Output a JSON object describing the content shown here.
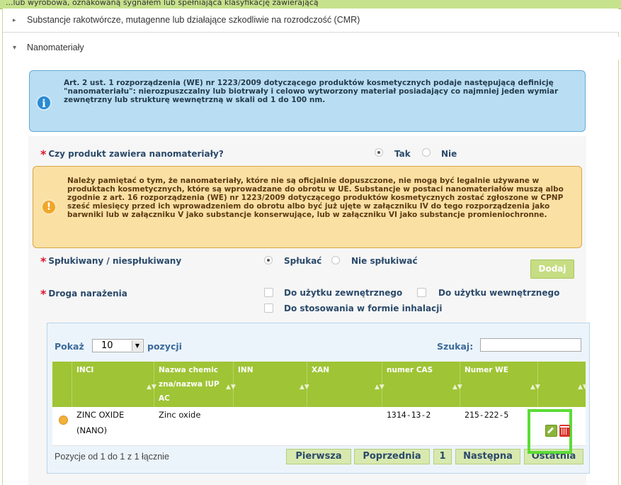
{
  "top_strip": {
    "text": "...lub wyrobowa, oznakowaną sygnałem lub spełniająca klasyfikację zawierającą"
  },
  "accordion": [
    {
      "label": "Substancje rakotwórcze, mutagenne lub działające szkodliwie na rozrodczość (CMR)",
      "state": "collapsed"
    },
    {
      "label": "Nanomateriały",
      "state": "expanded"
    }
  ],
  "info_box": {
    "text": "Art. 2 ust. 1 rozporządzenia (WE) nr 1223/2009 dotyczącego produktów kosmetycznych podaje następującą definicję \"nanomateriału\": nierozpuszczalny lub biotrwały i celowo wytworzony materiał posiadający co najmniej jeden wymiar zewnętrzny lub strukturę wewnętrzną w skali od 1 do 100 nm.",
    "icon": "info-icon",
    "color": "#b9def3"
  },
  "question_nano": {
    "required_marker": "*",
    "label": "Czy produkt zawiera nanomateriały?",
    "options": [
      "Tak",
      "Nie"
    ],
    "selected": "Tak"
  },
  "warning_box": {
    "text": "Należy pamiętać o tym, że nanomateriały, które nie są oficjalnie dopuszczone, nie mogą być legalnie używane w produktach kosmetycznych, które są wprowadzane do obrotu w UE. Substancje w postaci nanomateriałów muszą albo zgodnie z art. 16 rozporządzenia (WE) nr 1223/2009 dotyczącego produktów kosmetycznych zostać zgłoszone w CPNP sześć miesięcy przed ich wprowadzeniem do obrotu albo być już ujęte w załączniku IV do tego rozporządzenia jako barwniki lub w załączniku V jako substancje konserwujące, lub w załączniku VI jako substancje promieniochronne.",
    "icon": "warning-icon",
    "color": "#fbe0a4"
  },
  "question_rinse": {
    "required_marker": "*",
    "label": "Spłukiwany / niespłukiwany",
    "options": [
      "Spłukać",
      "Nie spłukiwać"
    ],
    "selected": "Spłukać"
  },
  "add_button": {
    "label": "Dodaj"
  },
  "question_exposure": {
    "required_marker": "*",
    "label": "Droga narażenia",
    "options": [
      "Do użytku zewnętrznego",
      "Do użytku wewnętrznego",
      "Do stosowania w formie inhalacji"
    ]
  },
  "table": {
    "show_label": "Pokaż",
    "page_size": "10",
    "entries_label": "pozycji",
    "search_label": "Szukaj:",
    "search_value": "",
    "columns": [
      "INCI",
      "Nazwa chemiczna/nazwa IUPAC",
      "INN",
      "XAN",
      "numer CAS",
      "Numer WE",
      ""
    ],
    "rows": [
      {
        "inci": "ZINC OXIDE (NANO)",
        "chem_name": "Zinc oxide",
        "inn": "",
        "xan": "",
        "cas": "1314-13-2",
        "we": "215-222-5"
      }
    ],
    "info": "Pozycje od 1 do 1 z 1 łącznie",
    "pagination": {
      "first": "Pierwsza",
      "prev": "Poprzednia",
      "page": "1",
      "next": "Następna",
      "last": "Ostatnia"
    }
  },
  "colors": {
    "header_green": "#9fc435",
    "highlight": "#5bdc36",
    "required": "#e0142c"
  }
}
